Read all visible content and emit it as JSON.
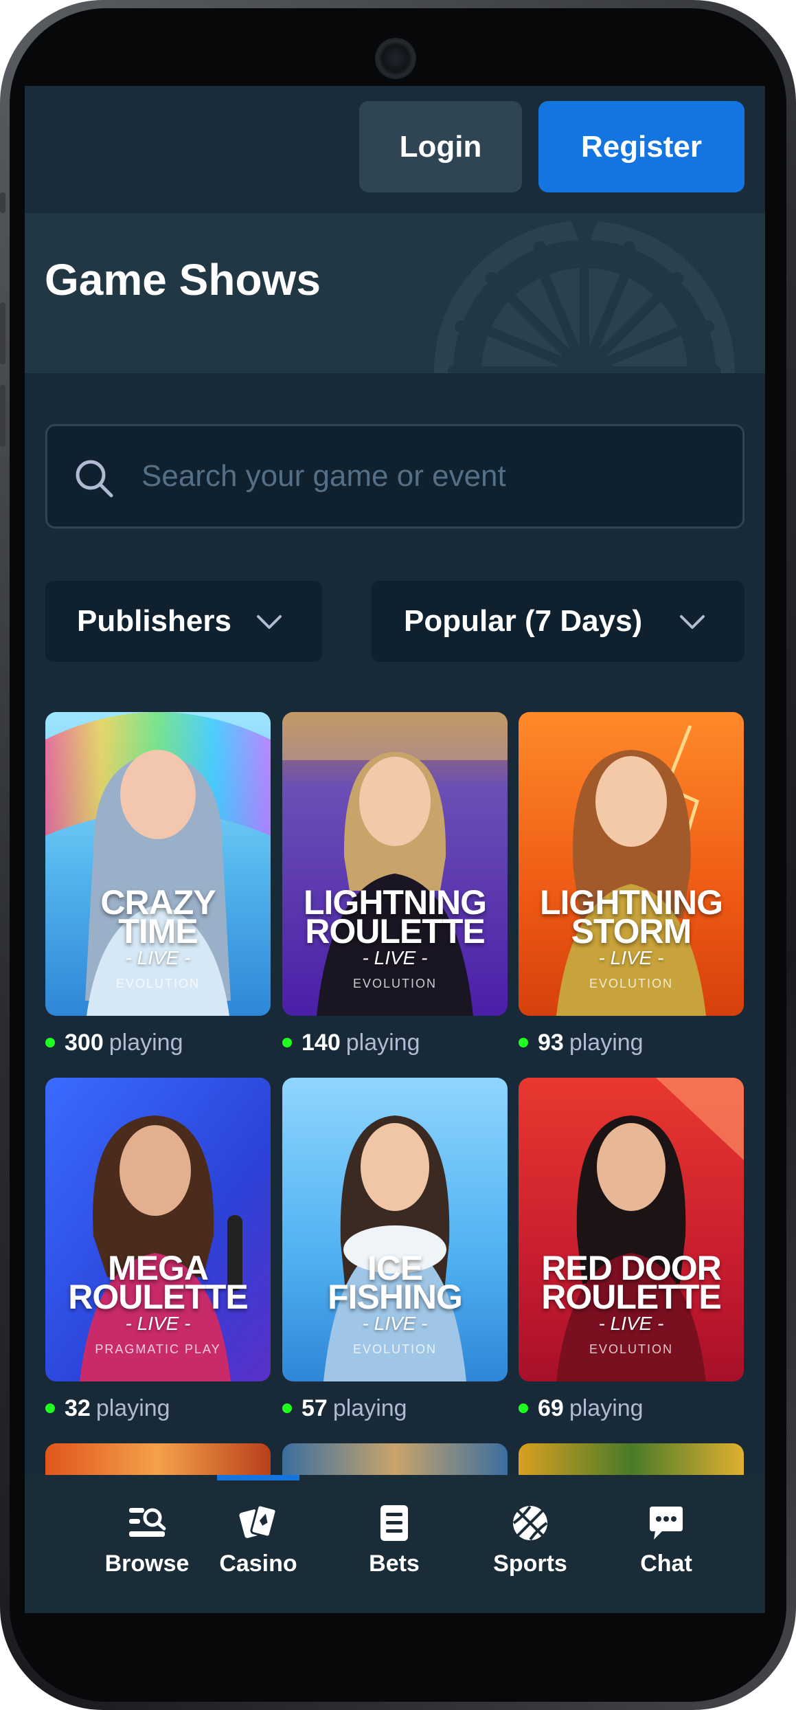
{
  "header": {
    "login_label": "Login",
    "register_label": "Register"
  },
  "banner": {
    "title": "Game Shows"
  },
  "search": {
    "placeholder": "Search your game or event"
  },
  "filters": {
    "publishers_label": "Publishers",
    "sort_label": "Popular (7 Days)"
  },
  "games": [
    {
      "title_line1": "CRAZY",
      "title_line2": "TIME",
      "sub": "- LIVE -",
      "publisher": "EVOLUTION",
      "players": "300",
      "status": "playing"
    },
    {
      "title_line1": "LIGHTNING",
      "title_line2": "ROULETTE",
      "sub": "- LIVE -",
      "publisher": "EVOLUTION",
      "players": "140",
      "status": "playing"
    },
    {
      "title_line1": "LIGHTNING",
      "title_line2": "STORM",
      "sub": "- LIVE -",
      "publisher": "EVOLUTION",
      "players": "93",
      "status": "playing"
    },
    {
      "title_line1": "MEGA",
      "title_line2": "ROULETTE",
      "sub": "- LIVE -",
      "publisher": "PRAGMATIC PLAY",
      "players": "32",
      "status": "playing"
    },
    {
      "title_line1": "ICE",
      "title_line2": "FISHING",
      "sub": "- LIVE -",
      "publisher": "EVOLUTION",
      "players": "57",
      "status": "playing"
    },
    {
      "title_line1": "RED DOOR",
      "title_line2": "ROULETTE",
      "sub": "- LIVE -",
      "publisher": "EVOLUTION",
      "players": "69",
      "status": "playing"
    }
  ],
  "nav": {
    "browse": "Browse",
    "casino": "Casino",
    "bets": "Bets",
    "sports": "Sports",
    "chat": "Chat",
    "active": "casino"
  },
  "colors": {
    "accent": "#1475e1",
    "online_dot": "#1fff20",
    "background": "#182a38"
  }
}
